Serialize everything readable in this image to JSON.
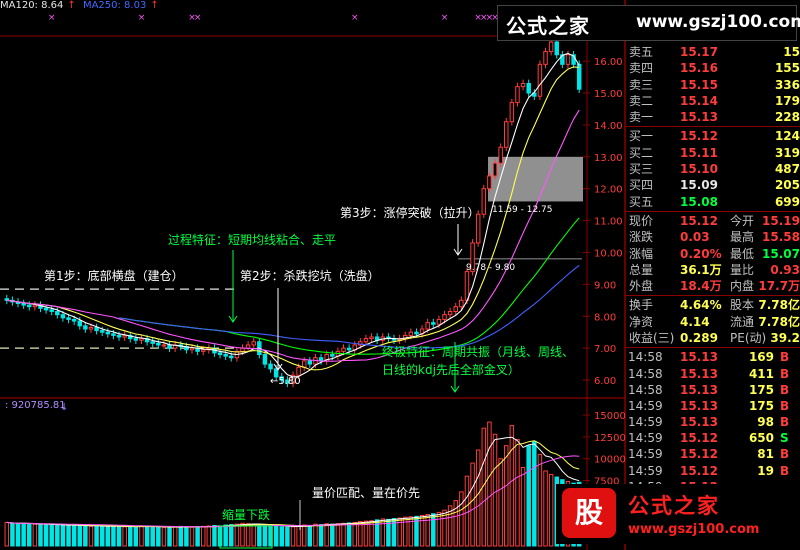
{
  "header": {
    "ma120": "MA120: 8.64",
    "ma250": "MA250: 8.03",
    "volume_readout": ": 920785.81"
  },
  "brand": {
    "name": "公式之家",
    "url": "www.gszj100.com",
    "logo_char": "股"
  },
  "quote": {
    "sell": [
      {
        "label": "卖五",
        "price": "15.17",
        "vol": "15"
      },
      {
        "label": "卖四",
        "price": "15.16",
        "vol": "155"
      },
      {
        "label": "卖三",
        "price": "15.15",
        "vol": "336"
      },
      {
        "label": "卖二",
        "price": "15.14",
        "vol": "179"
      },
      {
        "label": "卖一",
        "price": "15.13",
        "vol": "228"
      }
    ],
    "buy": [
      {
        "label": "买一",
        "price": "15.12",
        "vol": "124"
      },
      {
        "label": "买二",
        "price": "15.11",
        "vol": "319"
      },
      {
        "label": "买三",
        "price": "15.10",
        "vol": "487"
      },
      {
        "label": "买四",
        "price": "15.09",
        "vol": "205"
      },
      {
        "label": "买五",
        "price": "15.08",
        "vol": "699"
      }
    ],
    "stats": [
      {
        "l1": "现价",
        "v1": "15.12",
        "l2": "今开",
        "v2": "15.19"
      },
      {
        "l1": "涨跌",
        "v1": "0.03",
        "l2": "最高",
        "v2": "15.58"
      },
      {
        "l1": "涨幅",
        "v1": "0.20%",
        "l2": "最低",
        "v2": "15.07"
      },
      {
        "l1": "总量",
        "v1": "36.1万",
        "l2": "量比",
        "v2": "0.93"
      },
      {
        "l1": "外盘",
        "v1": "18.4万",
        "l2": "内盘",
        "v2": "17.7万"
      }
    ],
    "fin": [
      {
        "l1": "换手",
        "v1": "4.64%",
        "l2": "股本",
        "v2": "7.78亿"
      },
      {
        "l1": "净资",
        "v1": "4.14",
        "l2": "流通",
        "v2": "7.78亿"
      },
      {
        "l1": "收益(三)",
        "v1": "0.289",
        "l2": "PE(动)",
        "v2": "39.2"
      }
    ],
    "ticks": [
      {
        "time": "14:58",
        "price": "15.13",
        "vol": "169",
        "flag": "B"
      },
      {
        "time": "14:58",
        "price": "15.13",
        "vol": "411",
        "flag": "B"
      },
      {
        "time": "14:58",
        "price": "15.13",
        "vol": "175",
        "flag": "B"
      },
      {
        "time": "14:59",
        "price": "15.13",
        "vol": "175",
        "flag": "B"
      },
      {
        "time": "14:59",
        "price": "15.13",
        "vol": "98",
        "flag": "B"
      },
      {
        "time": "14:59",
        "price": "15.12",
        "vol": "650",
        "flag": "S"
      },
      {
        "time": "14:59",
        "price": "15.12",
        "vol": "81",
        "flag": "B"
      },
      {
        "time": "14:59",
        "price": "15.12",
        "vol": "19",
        "flag": "B"
      },
      {
        "time": "14:59",
        "price": "15.12",
        "vol": "",
        "flag": ""
      }
    ]
  },
  "chart_data": [
    {
      "type": "candlestick",
      "yticks": [
        6.0,
        7.0,
        8.0,
        9.0,
        10.0,
        11.0,
        12.0,
        13.0,
        14.0,
        15.0,
        16.0
      ],
      "ylim": [
        5.5,
        16.6
      ],
      "close": [
        8.5,
        8.45,
        8.4,
        8.35,
        8.3,
        8.35,
        8.25,
        8.2,
        8.15,
        8.05,
        7.95,
        7.9,
        7.85,
        7.7,
        7.6,
        7.65,
        7.55,
        7.5,
        7.45,
        7.4,
        7.35,
        7.4,
        7.3,
        7.25,
        7.3,
        7.2,
        7.15,
        7.1,
        7.1,
        7.0,
        7.1,
        7.05,
        6.95,
        7.0,
        6.9,
        6.95,
        7.0,
        6.85,
        6.8,
        6.75,
        6.7,
        6.9,
        7.0,
        7.1,
        7.2,
        6.8,
        6.5,
        6.35,
        6.1,
        6.0,
        5.9,
        6.15,
        6.4,
        6.6,
        6.5,
        6.7,
        6.6,
        6.8,
        6.75,
        6.9,
        7.0,
        6.95,
        7.1,
        7.2,
        7.3,
        7.35,
        7.25,
        7.35,
        7.3,
        7.25,
        7.3,
        7.4,
        7.5,
        7.45,
        7.6,
        7.8,
        7.75,
        7.9,
        8.05,
        8.15,
        8.3,
        8.5,
        9.4,
        10.3,
        11.2,
        12.0,
        12.4,
        12.8,
        13.3,
        14.1,
        14.7,
        15.2,
        15.3,
        15.0,
        14.9,
        15.9,
        16.3,
        16.6,
        16.2,
        15.9,
        16.2,
        15.9,
        15.12
      ],
      "annotations": [
        {
          "text": "第1步：底部横盘（建仓）"
        },
        {
          "text": "过程特征：短期均线粘合、走平"
        },
        {
          "text": "第2步：杀跌挖坑（洗盘）"
        },
        {
          "text": "第3步：涨停突破（拉升）"
        },
        {
          "text": "终极特征：周期共振（月线、周线、"
        },
        {
          "text": "日线的kdj先后全部金叉）"
        },
        {
          "text": "←5.80"
        },
        {
          "text": "9.78 - 9.80"
        },
        {
          "text": "11.59 - 12.75"
        }
      ]
    },
    {
      "type": "bar",
      "yticks": [
        7500,
        10000,
        12500,
        15000
      ],
      "ylim": [
        0,
        16500
      ],
      "volume": [
        2700,
        2600,
        2500,
        2600,
        2550,
        2500,
        2450,
        2400,
        2500,
        2400,
        2350,
        2300,
        2400,
        2350,
        2300,
        2250,
        2300,
        2250,
        2200,
        2300,
        2250,
        2200,
        2150,
        2200,
        2300,
        2250,
        2200,
        2150,
        2100,
        2150,
        2200,
        2250,
        2200,
        2150,
        2200,
        2250,
        2300,
        2350,
        2300,
        2400,
        2450,
        2500,
        2600,
        2550,
        2500,
        2450,
        2400,
        2350,
        2300,
        2200,
        2150,
        2200,
        2300,
        2400,
        2350,
        2500,
        2450,
        2550,
        2500,
        2550,
        2600,
        2650,
        2700,
        2800,
        2850,
        2900,
        3000,
        3100,
        3050,
        3150,
        3200,
        3300,
        3350,
        3400,
        3500,
        3600,
        3700,
        3850,
        4100,
        4600,
        5200,
        6200,
        8000,
        9500,
        11000,
        13500,
        14200,
        12800,
        10000,
        11500,
        13800,
        12200,
        9000,
        11500,
        12000,
        10500,
        8600,
        8200,
        7900,
        7600,
        7400,
        7200,
        7300
      ],
      "annotations": [
        {
          "text": "量价匹配、量在价先"
        },
        {
          "text": "缩量下跌"
        }
      ]
    }
  ]
}
